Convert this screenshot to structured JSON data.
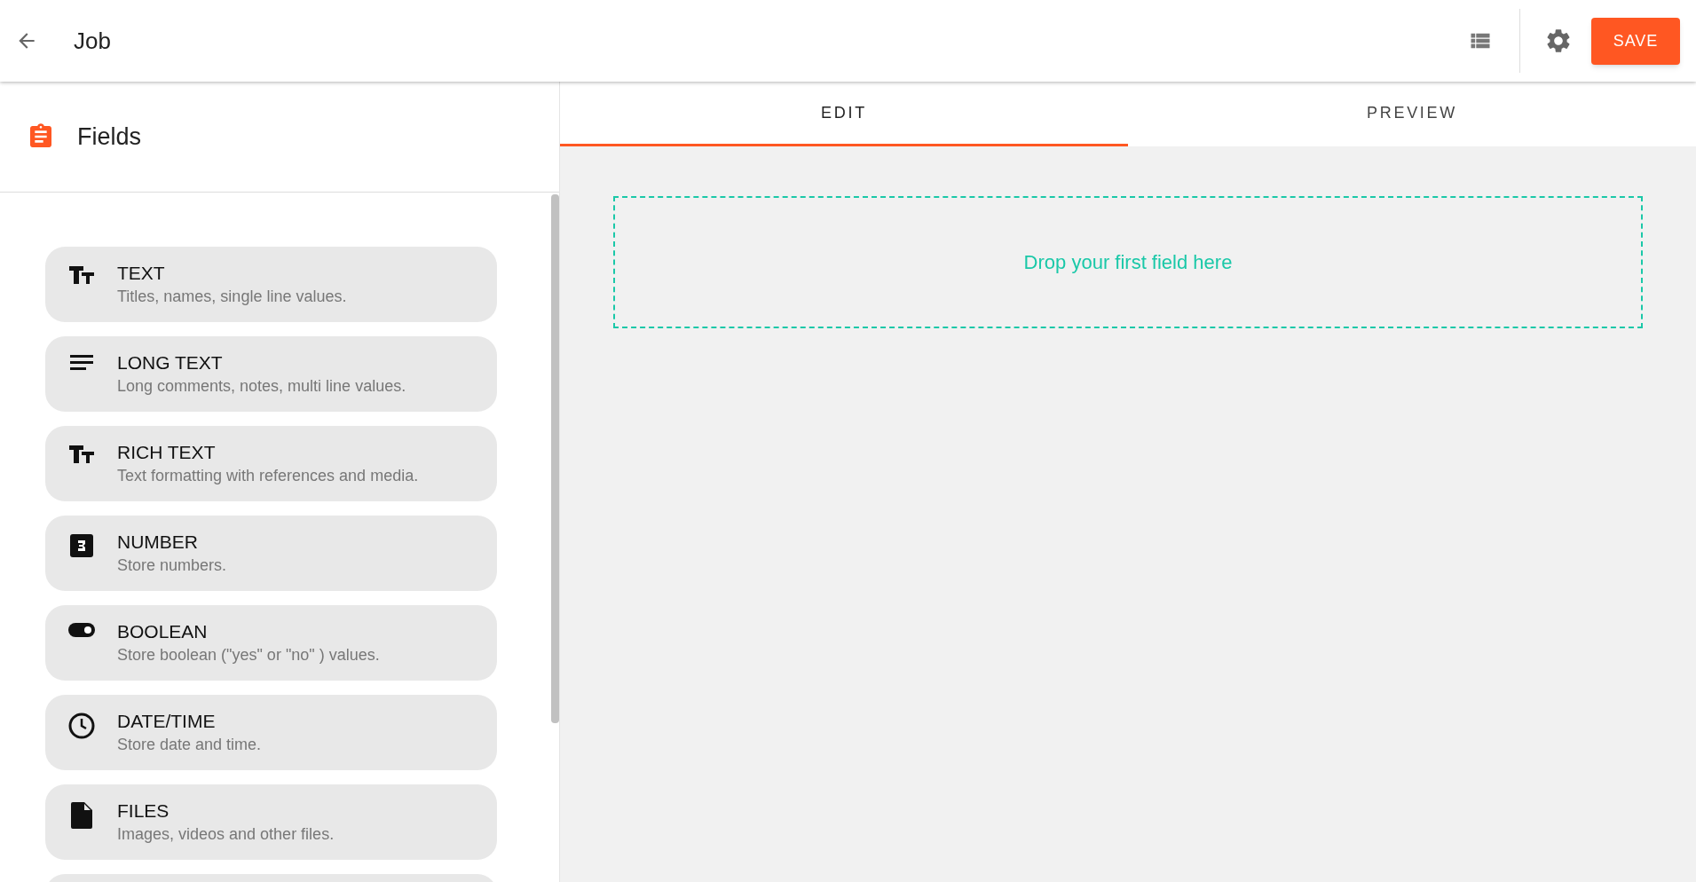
{
  "header": {
    "title": "Job",
    "save_button": "SAVE"
  },
  "sidebar": {
    "title": "Fields",
    "items": [
      {
        "kind": "text",
        "label": "TEXT",
        "description": "Titles, names, single line values."
      },
      {
        "kind": "long_text",
        "label": "LONG TEXT",
        "description": "Long comments, notes, multi line values."
      },
      {
        "kind": "rich_text",
        "label": "RICH TEXT",
        "description": "Text formatting with references and media."
      },
      {
        "kind": "number",
        "label": "NUMBER",
        "description": "Store numbers."
      },
      {
        "kind": "boolean",
        "label": "BOOLEAN",
        "description": "Store boolean (\"yes\" or \"no\" ) values."
      },
      {
        "kind": "datetime",
        "label": "DATE/TIME",
        "description": "Store date and time."
      },
      {
        "kind": "files",
        "label": "FILES",
        "description": "Images, videos and other files."
      }
    ]
  },
  "tabs": [
    {
      "label": "EDIT",
      "selected": true
    },
    {
      "label": "PREVIEW",
      "selected": false
    }
  ],
  "drop_zone": {
    "text": "Drop your first field here"
  }
}
